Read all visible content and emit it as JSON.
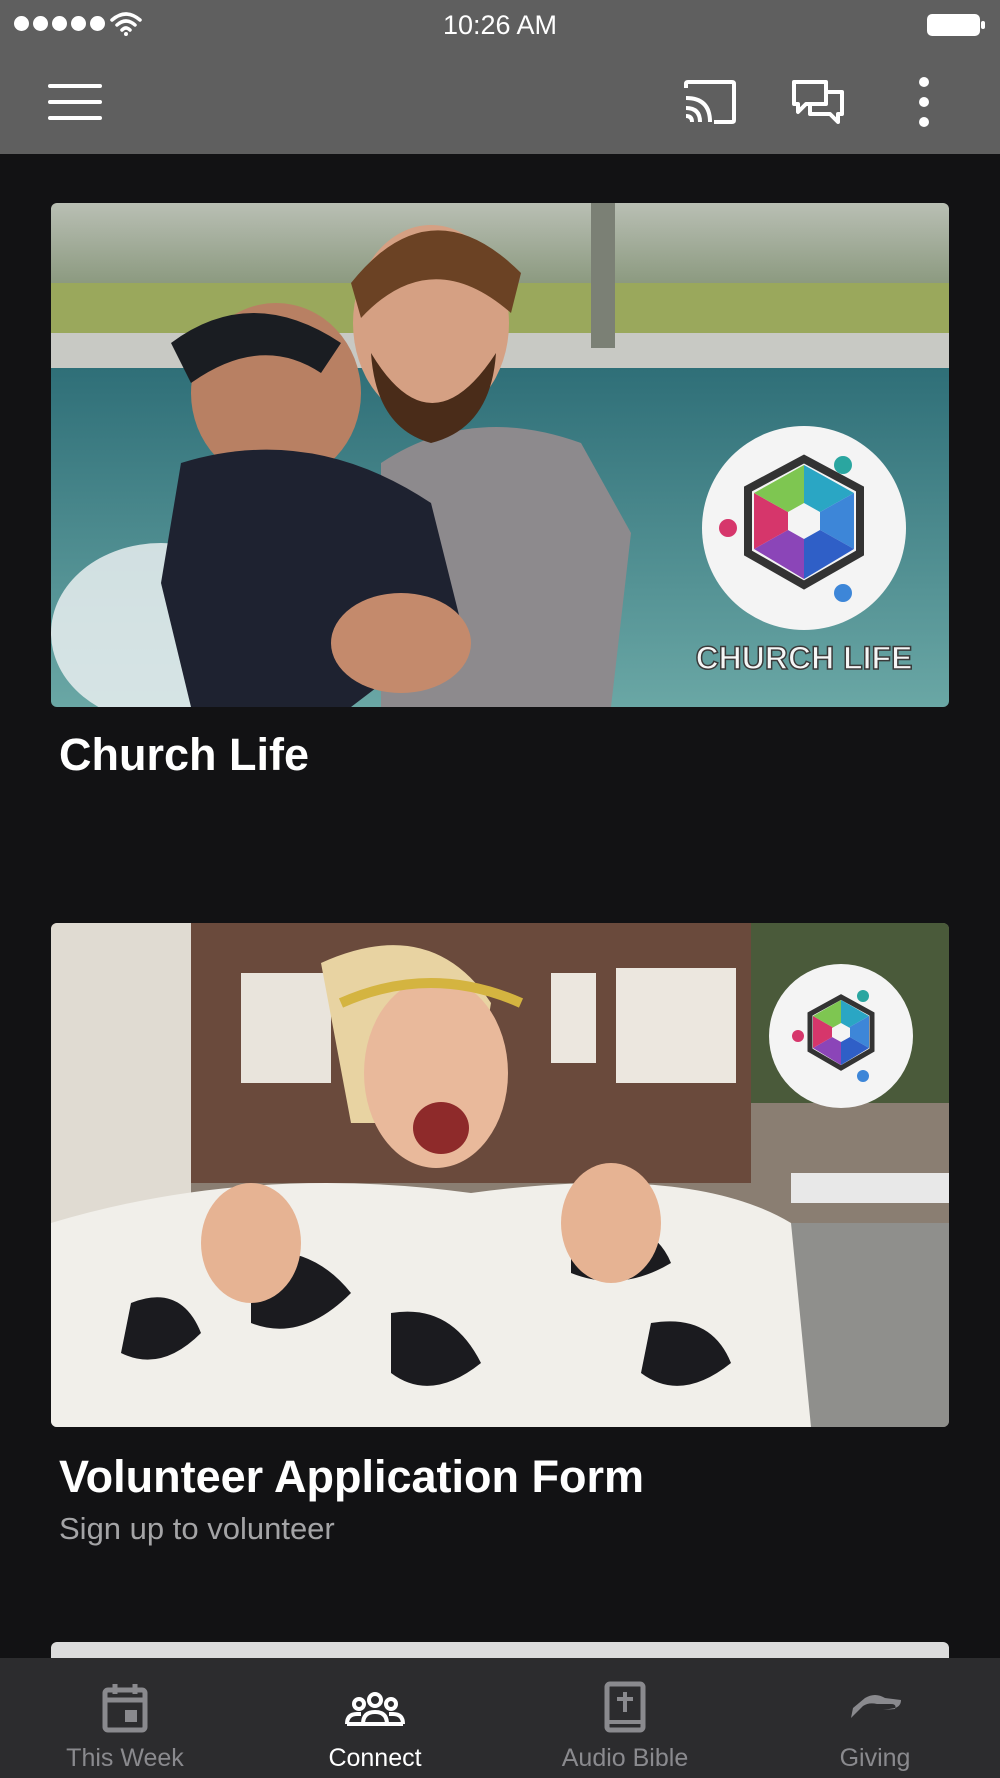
{
  "status": {
    "time": "10:26 AM"
  },
  "toolbar": {
    "menu_icon": "hamburger-icon",
    "cast_icon": "cast-icon",
    "chat_icon": "chat-icon",
    "more_icon": "more-vertical-icon"
  },
  "cards": [
    {
      "title": "Church Life",
      "subtitle": "",
      "badge_text": "CHURCH LIFE"
    },
    {
      "title": "Volunteer Application Form",
      "subtitle": "Sign up to volunteer"
    }
  ],
  "bottom_nav": [
    {
      "label": "This Week",
      "icon": "calendar-icon",
      "active": false
    },
    {
      "label": "Connect",
      "icon": "group-icon",
      "active": true
    },
    {
      "label": "Audio Bible",
      "icon": "bible-icon",
      "active": false
    },
    {
      "label": "Giving",
      "icon": "giving-hand-icon",
      "active": false
    }
  ],
  "colors": {
    "header": "#5f5f5f",
    "background": "#121214",
    "nav": "#2c2c2e",
    "nav_inactive": "#8a8a8e"
  }
}
